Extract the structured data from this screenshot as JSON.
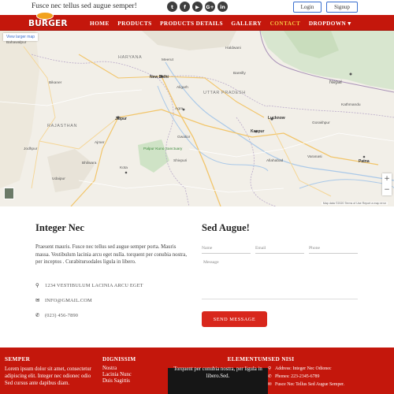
{
  "header": {
    "tagline": "Fusce nec tellus sed augue semper!",
    "social_icons": [
      "twitter-icon",
      "facebook-icon",
      "youtube-icon",
      "google-plus-icon",
      "linkedin-icon"
    ],
    "social_glyphs": [
      "t",
      "f",
      "▶",
      "G+",
      "in"
    ],
    "login_label": "Login",
    "signup_label": "Signup"
  },
  "brand": {
    "name": "BURGER",
    "accent": "#c4170c",
    "active_nav": "#f5c542"
  },
  "nav": {
    "items": [
      "HOME",
      "PRODUCTS",
      "PRODUCTS DETAILS",
      "GALLERY",
      "CONTACT",
      "DROPDOWN ▾"
    ],
    "active": "CONTACT"
  },
  "map": {
    "view_larger": "View larger map",
    "labels": {
      "haryana": "HARYANA",
      "delhi": "New Delhi",
      "uttar_pradesh": "UTTAR PRADESH",
      "rajasthan": "RAJASTHAN",
      "nepal": "Nepal",
      "bahawalpur": "Bahawalpur",
      "bikaner": "Bikaner",
      "jaipur": "Jaipur",
      "agra": "Agra",
      "lucknow": "Lucknow",
      "kanpur": "Kanpur",
      "kathmandu": "Kathmandu",
      "jodhpur": "Jodhpur",
      "udaipur": "Udaipur",
      "kota": "Kota",
      "patna": "Patna",
      "gwalior": "Gwalior",
      "haldwani": "Haldwani",
      "bareilly": "Bareilly",
      "palpur_kuno": "Palpur Kuno Sanctuary",
      "meerut": "Meerut",
      "aligarh": "Aligarh",
      "ajmer": "Ajmer",
      "bhilwara": "Bhilwara",
      "allahabad": "Allahabad",
      "varanasi": "Varanasi",
      "gorakhpur": "Gorakhpur",
      "shivpuri": "Shivpuri"
    },
    "attribution": "Map data ©2020  Terms of Use  Report a map error"
  },
  "contact": {
    "title": "Integer Nec",
    "text": "Praesent mauris. Fusce nec tellus sed augue semper porta. Mauris massa. Vestibulum lacinia arcu eget nulla. torquent per conubia nostra, per inceptos . Curabitursodales ligula in libero.",
    "address": "1234 VESTIBULUM LACINIA ARCU EGET",
    "email": "INFO@GMAIL.COM",
    "phone": "(023) 456-7890"
  },
  "form": {
    "title": "Sed Augue!",
    "name_placeholder": "Name",
    "email_placeholder": "Email",
    "phone_placeholder": "Phone",
    "message_placeholder": "Message",
    "send_label": "SEND MESSAGE"
  },
  "footer": {
    "col1": {
      "title": "SEMPER",
      "text": "Lorem ipsum dolor sit amet, consectetur adipiscing elit. Integer nec odionec odio Sed cursus ante dapibus diam."
    },
    "col2": {
      "title": "DIGNISSIM",
      "links": [
        "Nostra",
        "Lacinia Nunc",
        "Duis Sagittis"
      ]
    },
    "col3": {
      "title": "ELEMENTUM",
      "text": "Torquent per conubia nostra, per ligula in libero.Sed."
    },
    "col4": {
      "title": "SED NISI",
      "items": [
        "Address: Integer Nec Odionec",
        "Phones: 223-2345-6789",
        "Fusce Nec Tellus Sed Augue Semper."
      ]
    }
  }
}
